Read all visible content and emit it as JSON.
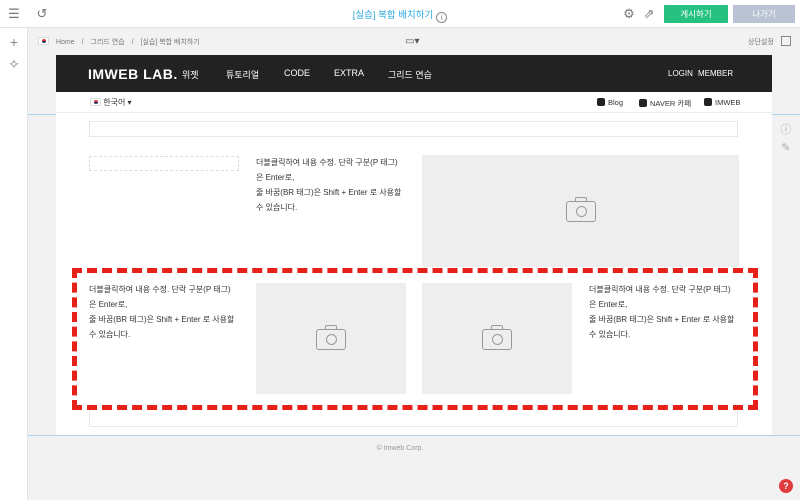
{
  "topbar": {
    "title": "[실습] 복합 배치하기",
    "info_icon": "i",
    "publish_label": "게시하기",
    "exit_label": "나가기"
  },
  "breadcrumb": {
    "home": "Home",
    "sep": "/",
    "section": "그리드 연습",
    "current": "[실습] 복합 배치하기"
  },
  "top_setting": "상단설정",
  "site": {
    "logo": "IMWEB LAB.",
    "nav": [
      "위젯",
      "튜토리얼",
      "CODE",
      "EXTRA",
      "그리드 연습"
    ],
    "login": "LOGIN",
    "member": "MEMBER",
    "lang": "한국어",
    "links": [
      "Blog",
      "NAVER 카페",
      "IMWEB"
    ]
  },
  "content": {
    "para_lines": [
      "더블클릭하여 내용 수정. 단락 구분(P 태그)",
      "은 Enter로,",
      "줄 바꿈(BR 태그)은 Shift + Enter 로 사용할",
      "수 있습니다."
    ]
  },
  "footer": "© Imweb Corp.",
  "help": "?",
  "colors": {
    "accent": "#2aa9e0",
    "publish": "#27c281",
    "exit": "#b9c3d4",
    "highlight": "#e8201a",
    "header": "#222222"
  }
}
